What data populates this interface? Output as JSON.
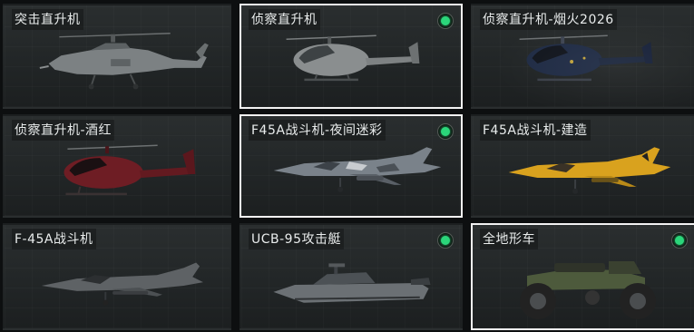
{
  "vehicles": [
    {
      "name": "突击直升机",
      "equipped": false,
      "selected": false,
      "icon": "attack-helicopter-icon"
    },
    {
      "name": "侦察直升机",
      "equipped": true,
      "selected": true,
      "icon": "scout-helicopter-icon"
    },
    {
      "name": "侦察直升机-烟火2026",
      "equipped": false,
      "selected": false,
      "icon": "scout-helicopter-fireworks-icon",
      "accent": "#1f2b44"
    },
    {
      "name": "侦察直升机-酒红",
      "equipped": false,
      "selected": false,
      "icon": "scout-helicopter-wine-red-icon",
      "accent": "#6e1d24"
    },
    {
      "name": "F45A战斗机-夜间迷彩",
      "equipped": true,
      "selected": true,
      "icon": "fighter-jet-night-camo-icon",
      "accent": "#7a828a"
    },
    {
      "name": "F45A战斗机-建造",
      "equipped": false,
      "selected": false,
      "icon": "fighter-jet-construction-icon",
      "accent": "#d9a21e"
    },
    {
      "name": "F-45A战斗机",
      "equipped": false,
      "selected": false,
      "icon": "stealth-fighter-icon"
    },
    {
      "name": "UCB-95攻击艇",
      "equipped": true,
      "selected": false,
      "icon": "attack-boat-icon"
    },
    {
      "name": "全地形车",
      "equipped": true,
      "selected": true,
      "icon": "atv-icon",
      "accent": "#4d5a3c"
    }
  ],
  "colors": {
    "equipped_dot": "#2bd67a",
    "selected_border": "#f2f2f2"
  }
}
